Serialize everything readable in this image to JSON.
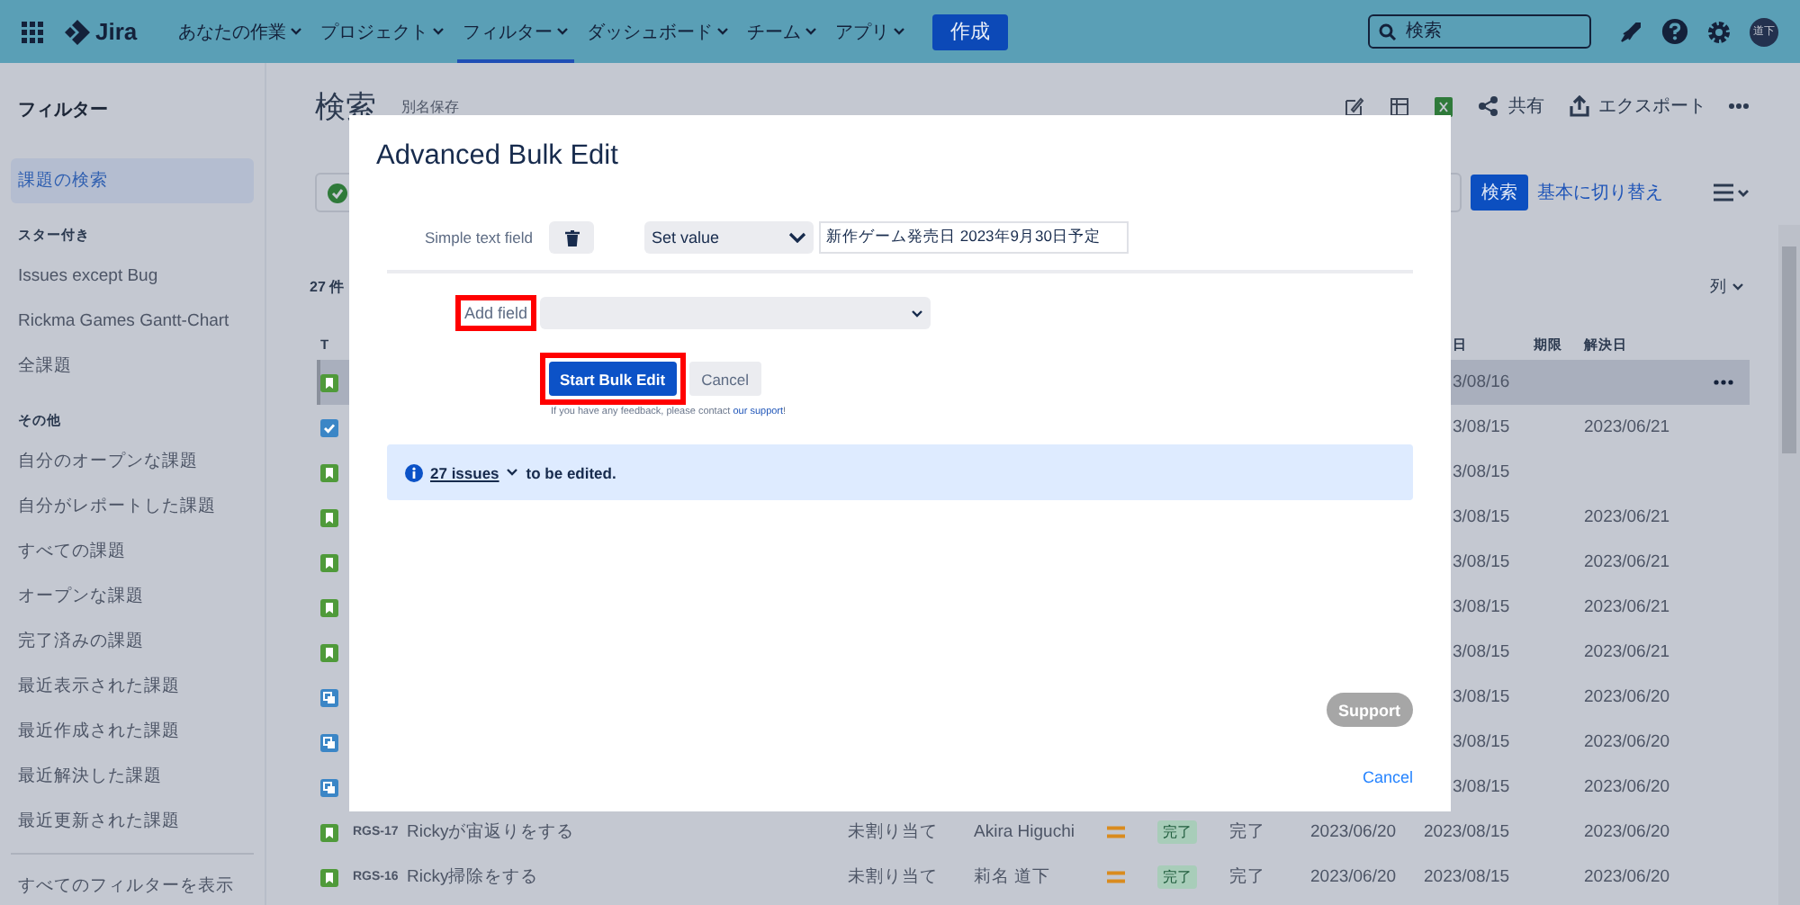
{
  "nav": {
    "items": [
      {
        "label": "あなたの作業",
        "selected": false
      },
      {
        "label": "プロジェクト",
        "selected": false
      },
      {
        "label": "フィルター",
        "selected": true
      },
      {
        "label": "ダッシュボード",
        "selected": false
      },
      {
        "label": "チーム",
        "selected": false
      },
      {
        "label": "アプリ",
        "selected": false
      }
    ],
    "product": "Jira",
    "create_button": "作成",
    "search": {
      "placeholder": "検索"
    },
    "avatar": "道下"
  },
  "sidebar": {
    "title": "フィルター",
    "items": [
      {
        "label": "課題の検索",
        "selected": true
      }
    ],
    "sections": [
      {
        "heading": "スター付き",
        "items": [
          {
            "label": "Issues except Bug",
            "selected": false
          },
          {
            "label": "Rickma Games Gantt-Chart",
            "selected": false
          },
          {
            "label": "全課題",
            "selected": false
          }
        ]
      },
      {
        "heading": "その他",
        "items": [
          {
            "label": "自分のオープンな課題",
            "selected": false
          },
          {
            "label": "自分がレポートした課題",
            "selected": false
          },
          {
            "label": "すべての課題",
            "selected": false
          },
          {
            "label": "オープンな課題",
            "selected": false
          },
          {
            "label": "完了済みの課題",
            "selected": false
          },
          {
            "label": "最近表示された課題",
            "selected": false
          },
          {
            "label": "最近作成された課題",
            "selected": false
          },
          {
            "label": "最近解決した課題",
            "selected": false
          },
          {
            "label": "最近更新された課題",
            "selected": false
          }
        ]
      }
    ],
    "footer_link": "すべてのフィルターを表示"
  },
  "page": {
    "title": "検索",
    "save_as": "別名保存",
    "share": "共有",
    "export": "エクスポート",
    "search_button": "検索",
    "switch_link": "基本に切り替え",
    "count": "27 件",
    "columns_button": "列"
  },
  "table": {
    "headers": {
      "type": "T",
      "updated": "日",
      "due": "期限",
      "resolved": "解決日"
    },
    "rows": [
      {
        "kind": "story",
        "selected": true,
        "updated": "3/08/16",
        "resolved": ""
      },
      {
        "kind": "task",
        "selected": false,
        "updated": "3/08/15",
        "resolved": "2023/06/21"
      },
      {
        "kind": "story",
        "selected": false,
        "updated": "3/08/15",
        "resolved": ""
      },
      {
        "kind": "story",
        "selected": false,
        "updated": "3/08/15",
        "resolved": "2023/06/21"
      },
      {
        "kind": "story",
        "selected": false,
        "updated": "3/08/15",
        "resolved": "2023/06/21"
      },
      {
        "kind": "story",
        "selected": false,
        "updated": "3/08/15",
        "resolved": "2023/06/21"
      },
      {
        "kind": "story",
        "selected": false,
        "updated": "3/08/15",
        "resolved": "2023/06/21"
      },
      {
        "kind": "subtask",
        "selected": false,
        "updated": "3/08/15",
        "resolved": "2023/06/20"
      },
      {
        "kind": "subtask",
        "selected": false,
        "updated": "3/08/15",
        "resolved": "2023/06/20"
      },
      {
        "kind": "subtask",
        "selected": false,
        "updated": "3/08/15",
        "resolved": "2023/06/20"
      },
      {
        "kind": "story",
        "selected": false,
        "key": "RGS-17",
        "summary": "Rickyが宙返りをする",
        "assignee": "未割り当て",
        "reporter": "Akira Higuchi",
        "status": "完了",
        "resolution": "完了",
        "created": "2023/06/20",
        "updated": "2023/08/15",
        "resolved": "2023/06/20"
      },
      {
        "kind": "story",
        "selected": false,
        "key": "RGS-16",
        "summary": "Ricky掃除をする",
        "assignee": "未割り当て",
        "reporter": "莉名 道下",
        "status": "完了",
        "resolution": "完了",
        "created": "2023/06/20",
        "updated": "2023/08/15",
        "resolved": "2023/06/20"
      }
    ]
  },
  "dialog": {
    "title": "Advanced Bulk Edit",
    "fields": [
      {
        "label": "Simple text field",
        "operation": "Set value",
        "value": "新作ゲーム発売日 2023年9月30日予定"
      }
    ],
    "add_field": {
      "label": "Add field",
      "highlighted": true
    },
    "start_button": {
      "label": "Start Bulk Edit",
      "highlighted": true
    },
    "cancel_button": "Cancel",
    "feedback": {
      "text": "If you have any feedback, please contact ",
      "link": "our support",
      "end": "!"
    },
    "banner": {
      "count_link": "27 issues",
      "text": "to be edited."
    },
    "support_button": "Support",
    "cancel_link": "Cancel"
  }
}
